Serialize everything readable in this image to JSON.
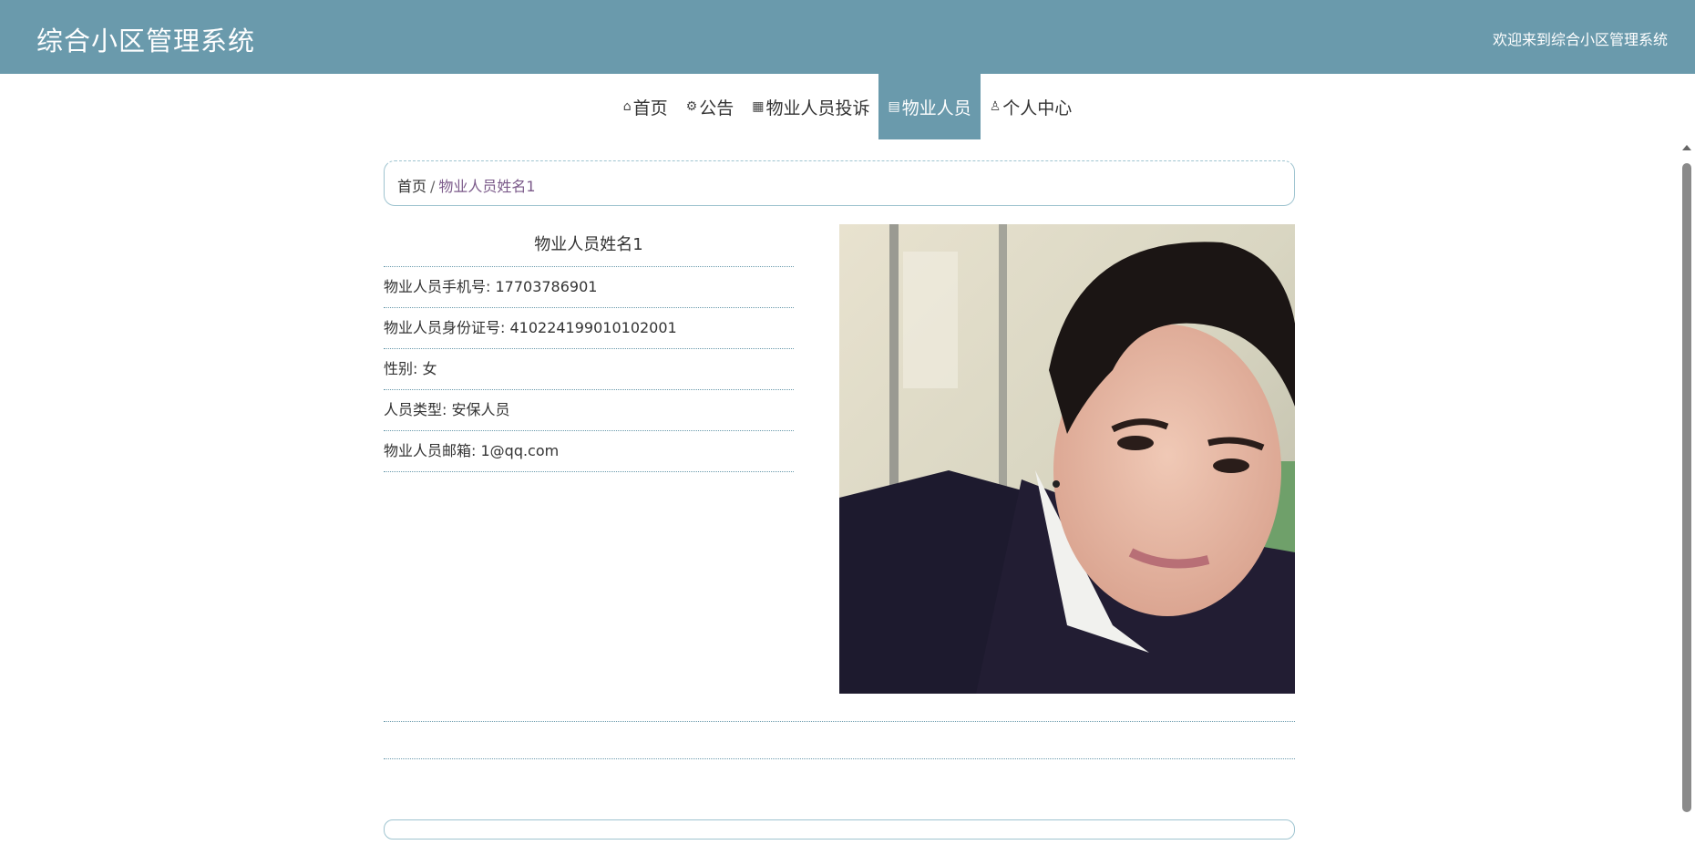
{
  "header": {
    "title": "综合小区管理系统",
    "welcome": "欢迎来到综合小区管理系统"
  },
  "nav": {
    "items": [
      {
        "icon": "home-icon",
        "label": "首页"
      },
      {
        "icon": "notice-icon",
        "label": "公告"
      },
      {
        "icon": "complaint-icon",
        "label": "物业人员投诉"
      },
      {
        "icon": "staff-icon",
        "label": "物业人员"
      },
      {
        "icon": "user-icon",
        "label": "个人中心"
      }
    ],
    "active": "物业人员"
  },
  "breadcrumb": {
    "home": "首页",
    "separator": "/",
    "current": "物业人员姓名1"
  },
  "detail": {
    "name": "物业人员姓名1",
    "fields": [
      "物业人员手机号: 17703786901",
      "物业人员身份证号: 410224199010102001",
      "性别: 女",
      "人员类型: 安保人员",
      "物业人员邮箱: 1@qq.com"
    ]
  },
  "colors": {
    "accent": "#6a9aac",
    "breadcrumb_current": "#7b5a8a"
  }
}
